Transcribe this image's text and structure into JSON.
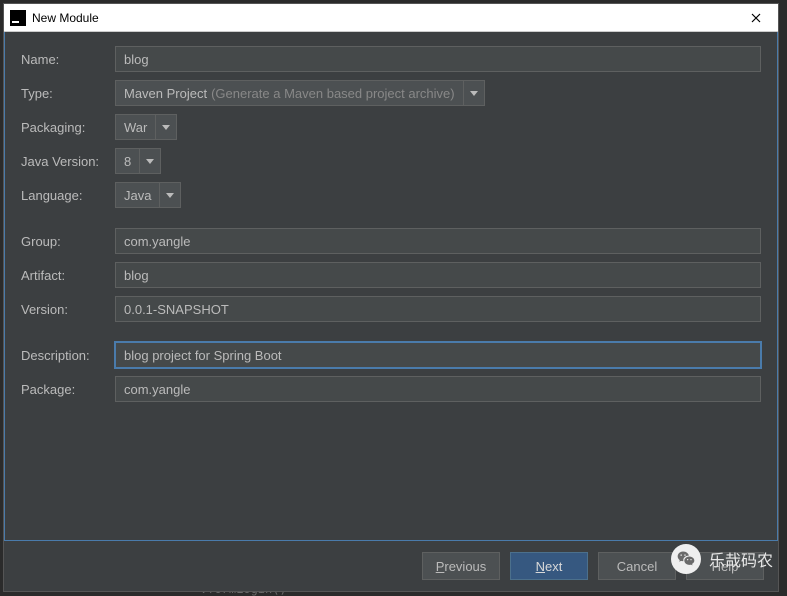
{
  "titlebar": {
    "icon_letter": "IJ",
    "title": "New Module"
  },
  "form": {
    "name": {
      "label": "Name:",
      "value": "blog"
    },
    "type": {
      "label": "Type:",
      "value": "Maven Project",
      "hint": "(Generate a Maven based project archive)"
    },
    "packaging": {
      "label": "Packaging:",
      "value": "War"
    },
    "javaVersion": {
      "label": "Java Version:",
      "value": "8"
    },
    "language": {
      "label": "Language:",
      "value": "Java"
    },
    "group": {
      "label": "Group:",
      "value": "com.yangle"
    },
    "artifact": {
      "label": "Artifact:",
      "value": "blog"
    },
    "version": {
      "label": "Version:",
      "value": "0.0.1-SNAPSHOT"
    },
    "description": {
      "label": "Description:",
      "value": "blog project for Spring Boot"
    },
    "package": {
      "label": "Package:",
      "value": "com.yangle"
    }
  },
  "footer": {
    "previous": "Previous",
    "next": "Next",
    "cancel": "Cancel",
    "help": "Help"
  },
  "watermark": "乐哉码农",
  "bg_code": ".formLogin()"
}
